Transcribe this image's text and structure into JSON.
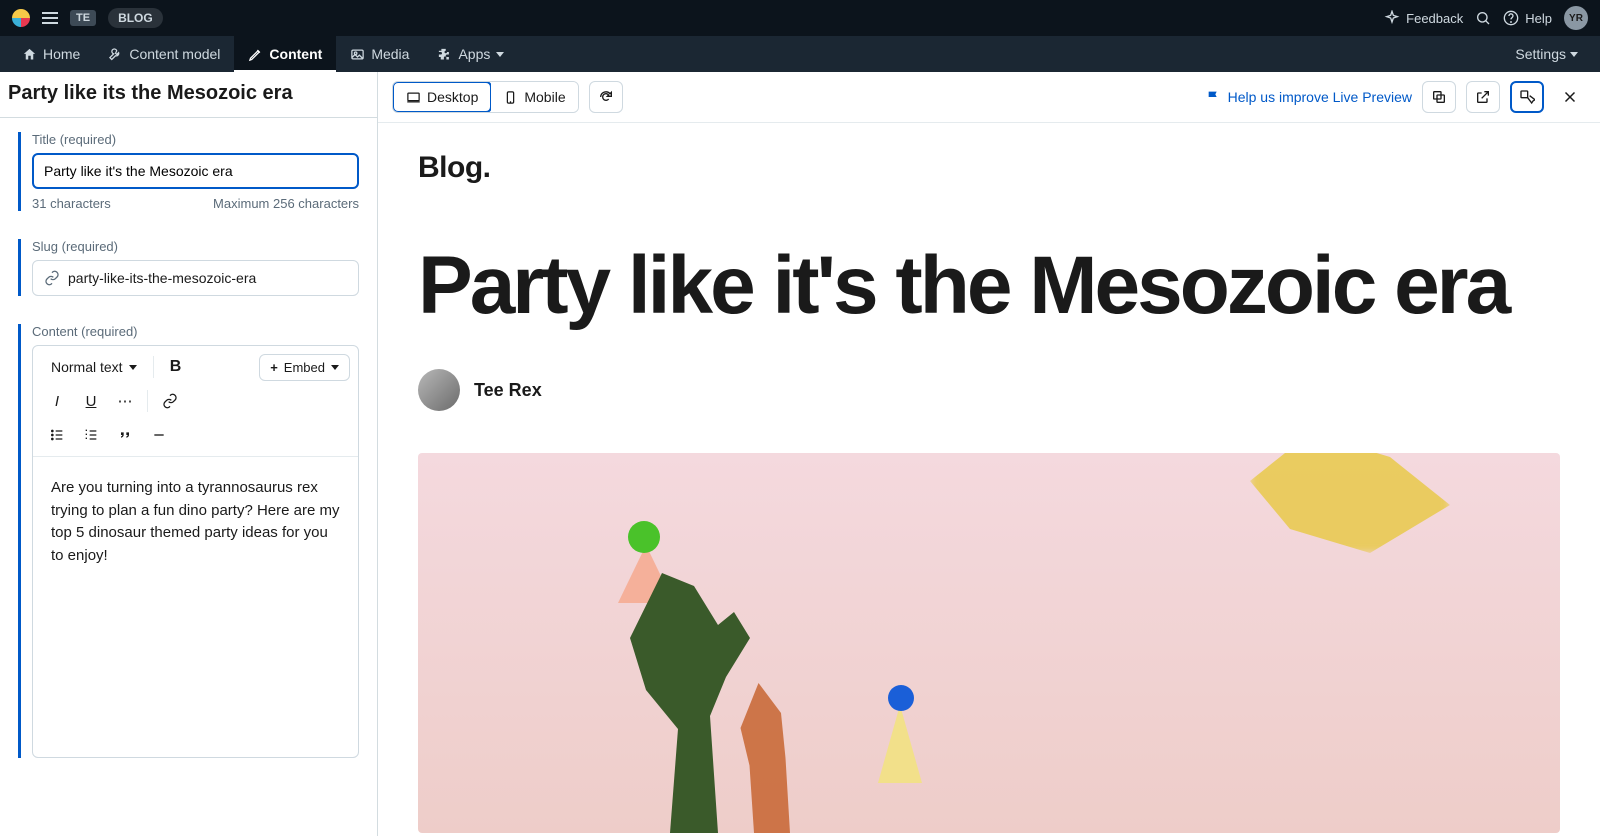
{
  "topbar": {
    "crumb_badge": "TE",
    "crumb_text": "BLOG",
    "feedback": "Feedback",
    "help": "Help",
    "avatar_initials": "YR"
  },
  "nav": {
    "home": "Home",
    "content_model": "Content model",
    "content": "Content",
    "media": "Media",
    "apps": "Apps",
    "settings": "Settings"
  },
  "editor": {
    "page_title": "Party like its the Mesozoic era",
    "title_field": {
      "label": "Title (required)",
      "value": "Party like it's the Mesozoic era",
      "char_count": "31 characters",
      "max": "Maximum 256 characters"
    },
    "slug_field": {
      "label": "Slug (required)",
      "value": "party-like-its-the-mesozoic-era"
    },
    "content_field": {
      "label": "Content (required)",
      "format_selector": "Normal text",
      "embed_label": "Embed",
      "body": "Are you turning into a tyrannosaurus rex trying to plan a fun dino party? Here are my top 5 dinosaur themed party ideas for you to enjoy!"
    }
  },
  "preview_bar": {
    "desktop": "Desktop",
    "mobile": "Mobile",
    "help_link": "Help us improve Live Preview"
  },
  "preview": {
    "blog_label": "Blog.",
    "title": "Party like it's the Mesozoic era",
    "author": "Tee Rex"
  }
}
